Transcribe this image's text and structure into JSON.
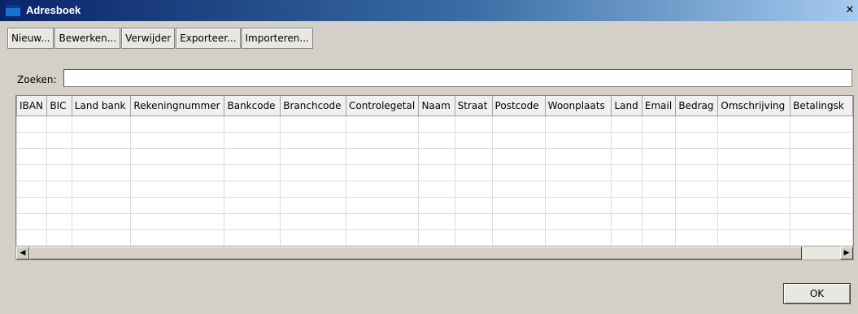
{
  "window": {
    "title": "Adresboek",
    "close_glyph": "✕"
  },
  "toolbar": {
    "buttons": [
      "Nieuw...",
      "Bewerken...",
      "Verwijder",
      "Exporteer...",
      "Importeren..."
    ]
  },
  "search": {
    "label": "Zoeken:",
    "value": ""
  },
  "table": {
    "columns": [
      "IBAN",
      "BIC",
      "Land bank",
      "Rekeningnummer",
      "Bankcode",
      "Branchcode",
      "Controlegetal",
      "Naam",
      "Straat",
      "Postcode",
      "Woonplaats",
      "Land",
      "Email",
      "Bedrag",
      "Omschrijving",
      "Betalingsk"
    ],
    "empty_rows": 8
  },
  "scrollbar": {
    "left_glyph": "◀",
    "right_glyph": "▶"
  },
  "footer": {
    "ok_label": "OK"
  }
}
